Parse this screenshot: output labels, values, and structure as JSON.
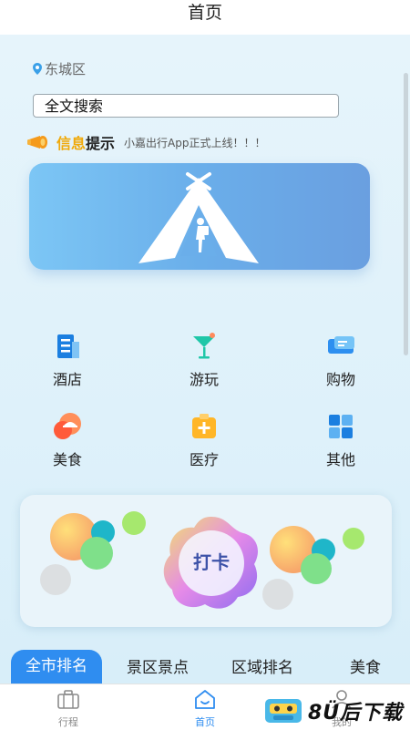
{
  "header": {
    "title": "首页"
  },
  "location": {
    "label": "东城区"
  },
  "search": {
    "placeholder": "全文搜索"
  },
  "notice": {
    "title_highlight": "信息",
    "title_rest": "提示",
    "message": "小嘉出行App正式上线！！！"
  },
  "categories": [
    {
      "label": "酒店",
      "icon": "hotel-building-icon"
    },
    {
      "label": "游玩",
      "icon": "cocktail-icon"
    },
    {
      "label": "购物",
      "icon": "shopping-ticket-icon"
    },
    {
      "label": "美食",
      "icon": "food-cloche-icon"
    },
    {
      "label": "医疗",
      "icon": "medical-kit-icon"
    },
    {
      "label": "其他",
      "icon": "grid-apps-icon"
    }
  ],
  "checkin": {
    "label": "打卡"
  },
  "tabs": [
    {
      "label": "全市排名",
      "active": true
    },
    {
      "label": "景区景点"
    },
    {
      "label": "区域排名"
    },
    {
      "label": "美食"
    }
  ],
  "bottom_nav": [
    {
      "label": "行程",
      "icon": "suitcase-icon"
    },
    {
      "label": "首页",
      "icon": "home-icon",
      "active": true
    },
    {
      "label": "我的",
      "icon": "user-icon"
    }
  ],
  "watermark": {
    "text": "8Ü后下载"
  },
  "colors": {
    "accent": "#2f8df0",
    "notice_highlight": "#f0a90a",
    "banner_start": "#7cc6f5",
    "banner_end": "#6a9fe0"
  }
}
